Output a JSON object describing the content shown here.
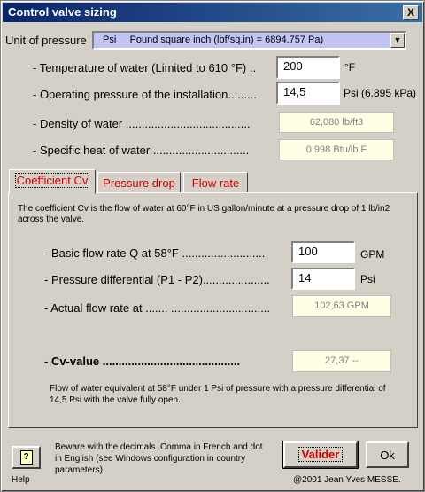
{
  "window": {
    "title": "Control valve sizing",
    "close_glyph": "X"
  },
  "unit": {
    "label": "Unit of pressure",
    "selected_code": "Psi",
    "selected_desc": "Pound square inch (lbf/sq.in) = 6894.757 Pa)",
    "arrow": "▼"
  },
  "fields": {
    "temperature": {
      "label": "- Temperature of water (Limited to 610 °F) ..",
      "value": "200",
      "unit": "°F"
    },
    "pressure": {
      "label": "- Operating pressure of the installation.........",
      "value": "14,5",
      "unit": "Psi (6.895 kPa)"
    },
    "density": {
      "label": "- Density of water .......................................",
      "value": "62,080 lb/ft3"
    },
    "specific_heat": {
      "label": "- Specific heat of water ..............................",
      "value": "0,998 Btu/lb.F"
    }
  },
  "tabs": [
    {
      "label": "Coefficient Cv"
    },
    {
      "label": "Pressure drop"
    },
    {
      "label": "Flow rate"
    }
  ],
  "cv_tab": {
    "description": "The coefficient Cv is the flow of water at 60°F in US gallon/minute at a pressure drop of 1 lb/in2 across the valve.",
    "basic_flow": {
      "label": "- Basic flow rate Q at 58°F ..........................",
      "value": "100",
      "unit": "GPM"
    },
    "pressure_diff": {
      "label": "- Pressure differential (P1 - P2).....................",
      "value": "14",
      "unit": "Psi"
    },
    "actual_flow": {
      "label": "- Actual flow rate at ....... ...............................",
      "value": "102,63 GPM"
    },
    "cv_value": {
      "label": "- Cv-value ...........................................",
      "value": "27,37 --"
    },
    "note": "Flow of water equivalent at 58°F under 1 Psi of pressure with a pressure differential of 14,5 Psi with the valve fully open."
  },
  "footer": {
    "help_glyph": "?",
    "help_label": "Help",
    "warning": "Beware with the decimals. Comma in French and dot in English (see Windows configuration in country parameters)",
    "validate_label": "Valider",
    "ok_label": "Ok",
    "copyright": "@2001 Jean Yves MESSE."
  }
}
